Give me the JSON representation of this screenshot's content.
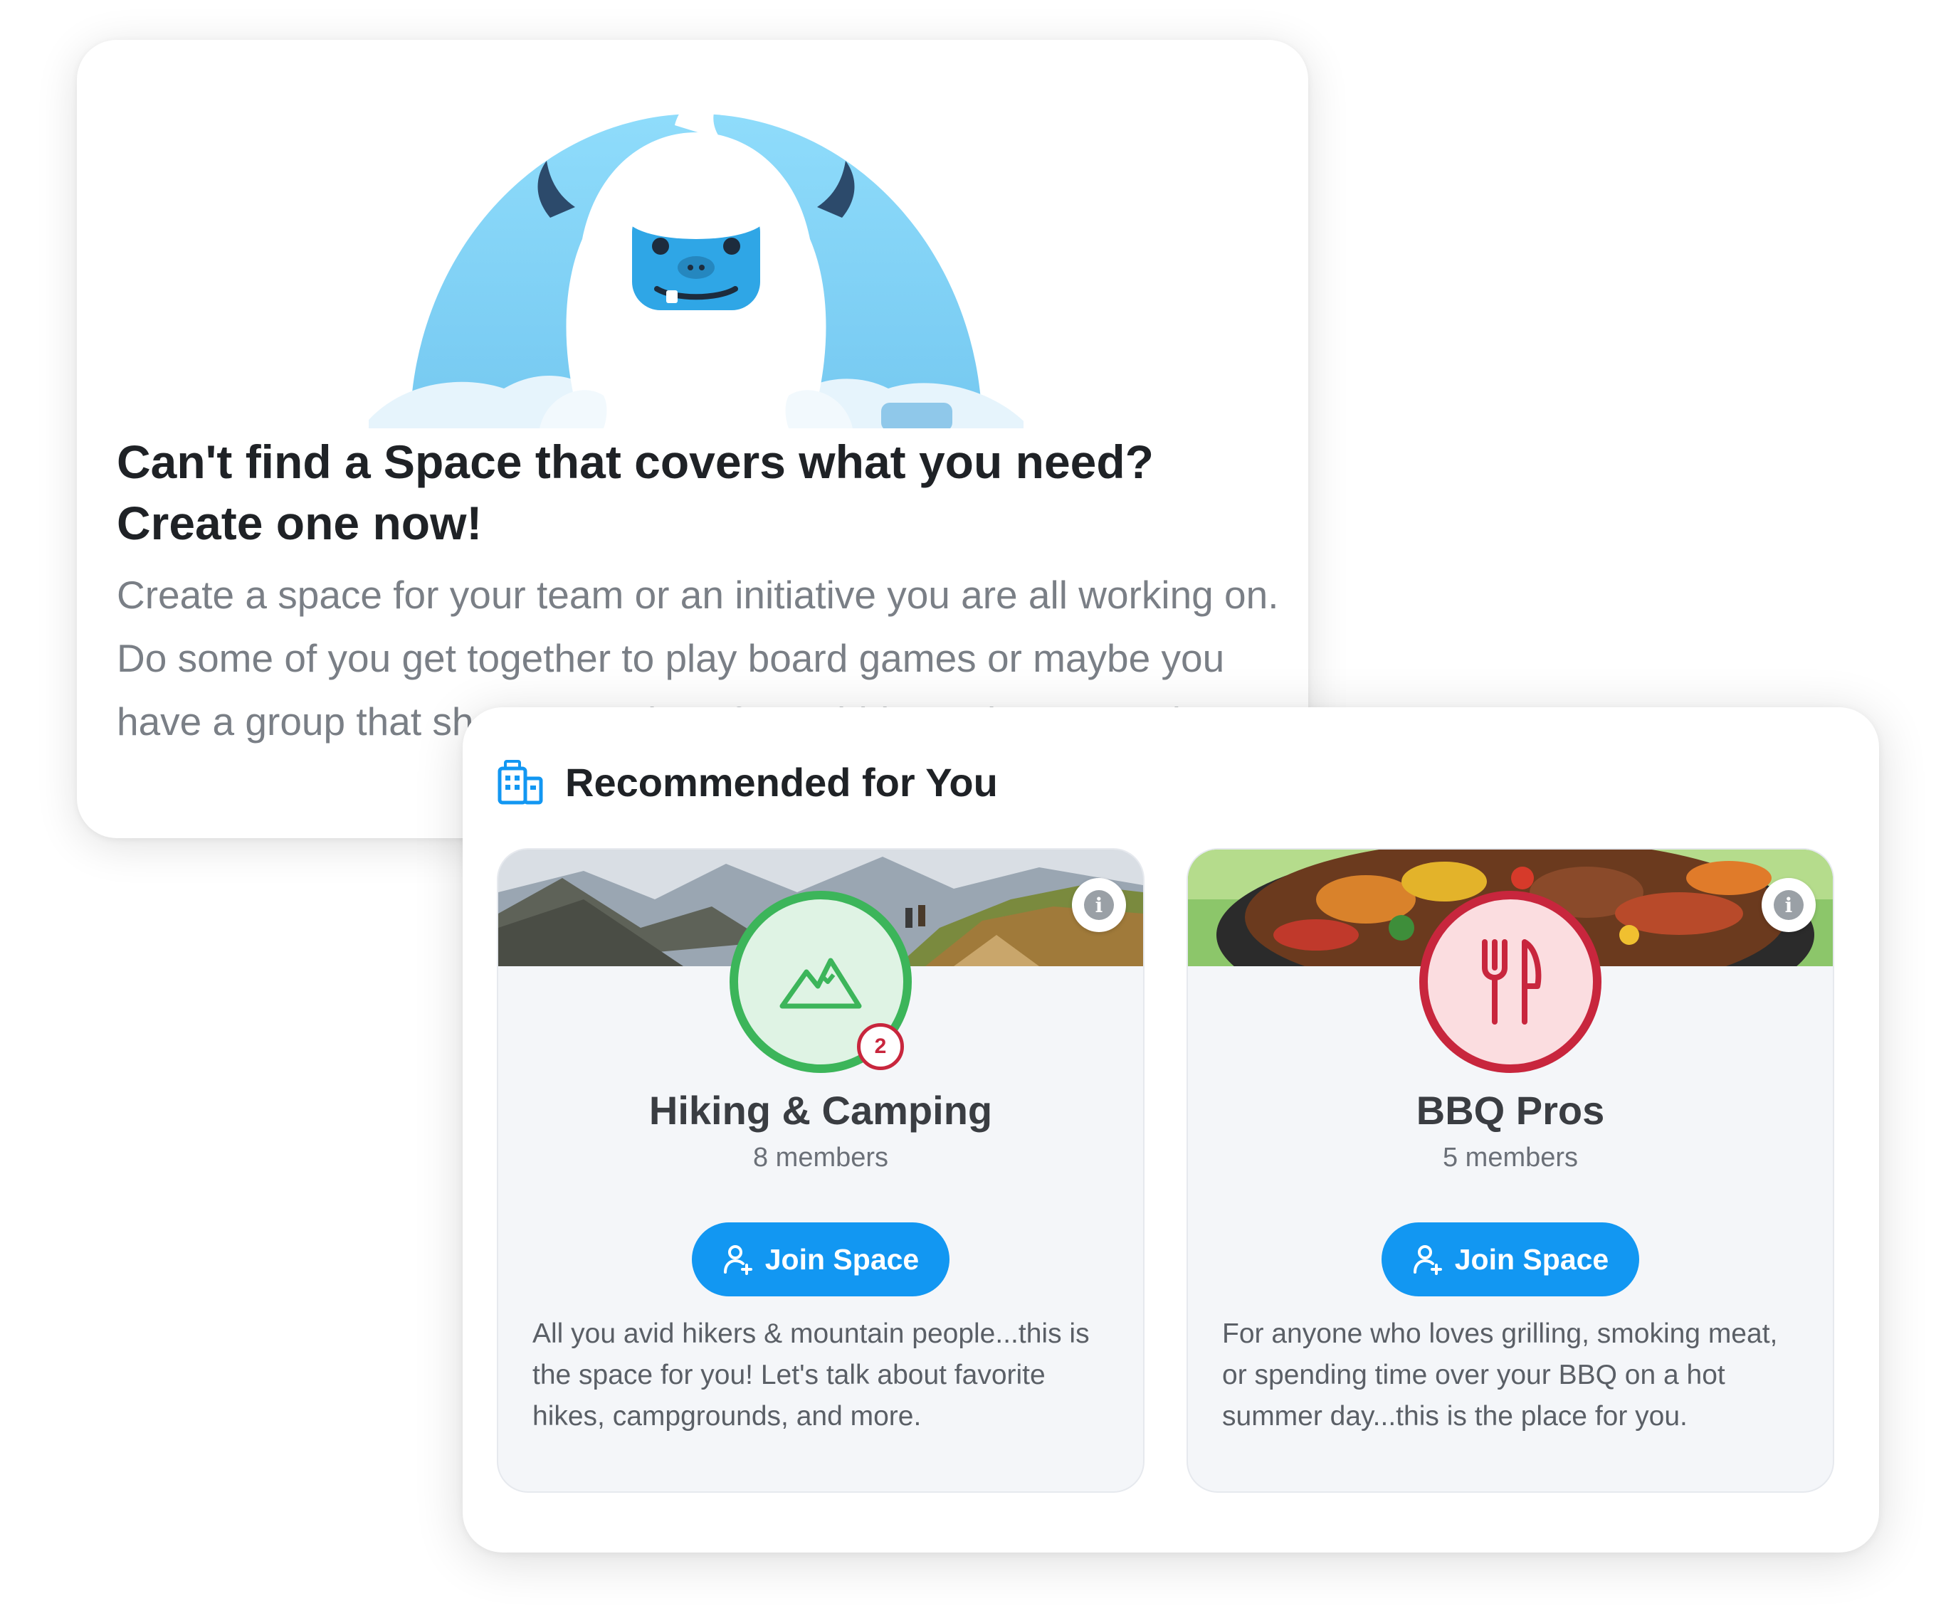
{
  "create_card": {
    "title_line1": "Can't find a Space that covers what you need?",
    "title_line2": "Create one now!",
    "body": "Create a space for your team or an initiative you are all working on. Do some of you get together to play board games or maybe you have a group that shares your love for Hobbits or the mountains?"
  },
  "recommended": {
    "title": "Recommended for You",
    "icon": "building-icon",
    "spaces": [
      {
        "name": "Hiking & Camping",
        "members": "8 members",
        "badge": "2",
        "icon": "mountain-icon",
        "accent": "#3cb55a",
        "join_label": "Join Space",
        "description": "All you avid hikers & mountain people...this is the space for you! Let's talk about favorite hikes, campgrounds, and more."
      },
      {
        "name": "BBQ Pros",
        "members": "5 members",
        "icon": "fork-knife-icon",
        "accent": "#c8263d",
        "join_label": "Join Space",
        "description": "For anyone who loves grilling, smoking meat, or spending time over your BBQ on a hot summer day...this is the place for you."
      }
    ]
  },
  "colors": {
    "join_button": "#1297f2",
    "yeti_background": "#8fd3f5"
  }
}
